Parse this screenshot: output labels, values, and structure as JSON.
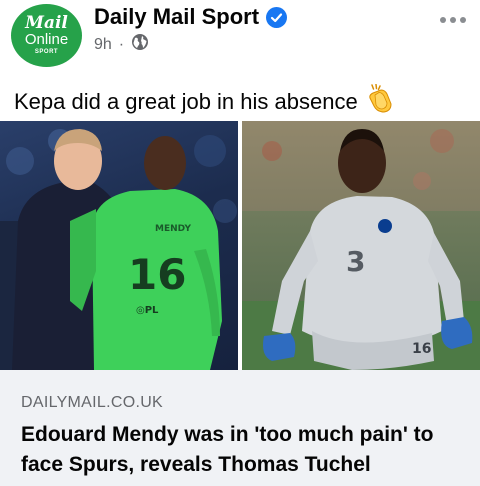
{
  "post": {
    "avatar": {
      "line1": "Mail",
      "line2": "Online",
      "line3": "SPORT"
    },
    "page_name": "Daily Mail Sport",
    "timestamp": "9h",
    "separator": "·",
    "text": "Kepa did a great job in his absence",
    "emoji_name": "clapping-hands-icon"
  },
  "photos": {
    "left": {
      "shirt_name": "MENDY",
      "shirt_number": "16"
    },
    "right": {
      "shorts_number": "16"
    }
  },
  "link_preview": {
    "domain": "DAILYMAIL.CO.UK",
    "headline": "Edouard Mendy was in 'too much pain' to face Spurs, reveals Thomas Tuchel"
  },
  "colors": {
    "brand_green": "#26a24a",
    "verified_blue": "#1877f2",
    "secondary_text": "#65676b",
    "preview_bg": "#f0f2f5",
    "goalkeeper_green": "#3ed05a"
  }
}
